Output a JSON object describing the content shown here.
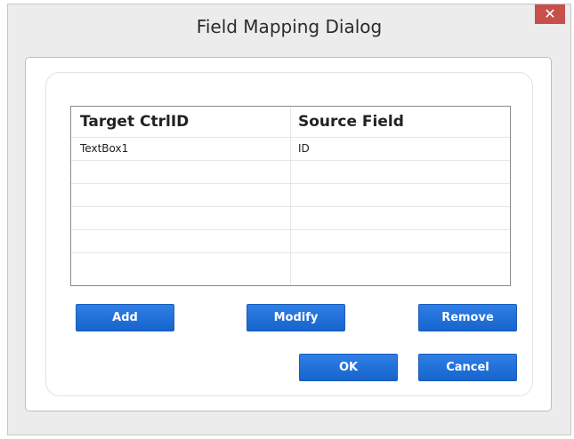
{
  "dialog": {
    "title": "Field Mapping Dialog",
    "close_glyph": "✕"
  },
  "grid": {
    "columns": [
      "Target CtrlID",
      "Source Field"
    ],
    "rows": [
      [
        "TextBox1",
        "ID"
      ],
      [
        "",
        ""
      ],
      [
        "",
        ""
      ],
      [
        "",
        ""
      ],
      [
        "",
        ""
      ],
      [
        "",
        ""
      ]
    ]
  },
  "buttons": {
    "add": "Add",
    "modify": "Modify",
    "remove": "Remove",
    "ok": "OK",
    "cancel": "Cancel"
  },
  "colors": {
    "button_blue": "#1e6fd9",
    "close_red": "#c7504b"
  }
}
